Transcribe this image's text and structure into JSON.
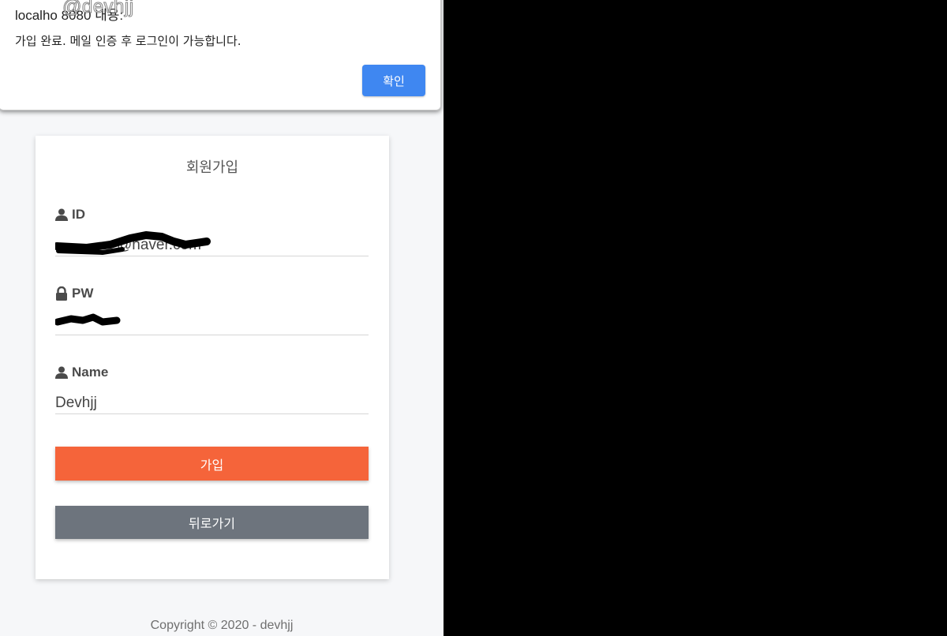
{
  "dialog": {
    "title": "localho  8080 내용:",
    "watermark": "@devhjj",
    "message": "가입 완료. 메일 인증 후 로그인이 가능합니다.",
    "ok_label": "확인"
  },
  "form": {
    "title": "회원가입",
    "id_label": "ID",
    "id_value": "@naver.com",
    "pw_label": "PW",
    "name_label": "Name",
    "name_value": "Devhjj",
    "join_label": "가입",
    "back_label": "뒤로가기"
  },
  "footer": {
    "copyright": "Copyright © 2020 - devhjj"
  },
  "icons": {
    "id": "user-icon",
    "pw": "lock-icon",
    "name": "user-icon"
  },
  "colors": {
    "primary": "#f5643a",
    "secondary": "#6d747d",
    "dialog_button": "#3f87f1"
  }
}
